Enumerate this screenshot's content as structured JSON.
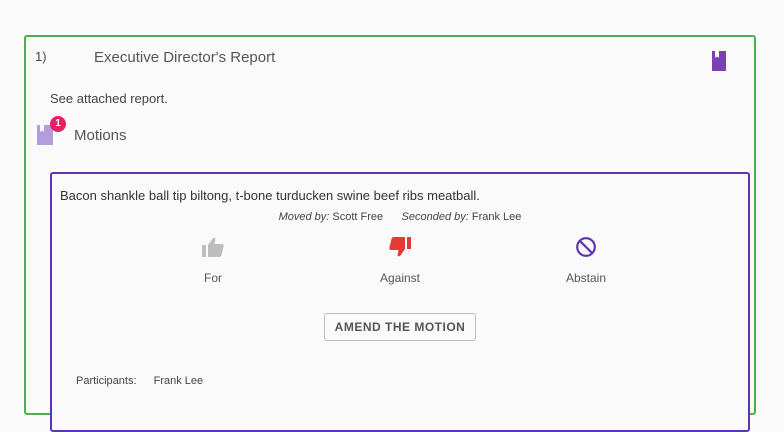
{
  "agenda_item": {
    "number": "1)",
    "title": "Executive Director's Report",
    "body": "See attached report.",
    "border_color": "#4caf50",
    "bookmark_icon": "bookmark-icon",
    "bookmark_color": "#7b3fb6"
  },
  "motions": {
    "label": "Motions",
    "count": "1",
    "badge_color": "#e91e63",
    "icon": "bookmark-icon",
    "icon_color": "#b39ddb"
  },
  "motion": {
    "text": "Bacon shankle ball tip biltong, t-bone turducken swine beef ribs meatball.",
    "moved_by_label": "Moved by:",
    "moved_by": "Scott Free",
    "seconded_by_label": "Seconded by:",
    "seconded_by": "Frank Lee",
    "border_color": "#5e35b1",
    "votes": {
      "for_label": "For",
      "for_icon": "thumbs-up-icon",
      "for_color": "#bdbdbd",
      "against_label": "Against",
      "against_icon": "thumbs-down-icon",
      "against_color": "#e53935",
      "abstain_label": "Abstain",
      "abstain_icon": "block-icon",
      "abstain_color": "#5e35b1"
    },
    "amend_label": "AMEND THE MOTION",
    "participants_label": "Participants:",
    "participants": "Frank Lee"
  }
}
